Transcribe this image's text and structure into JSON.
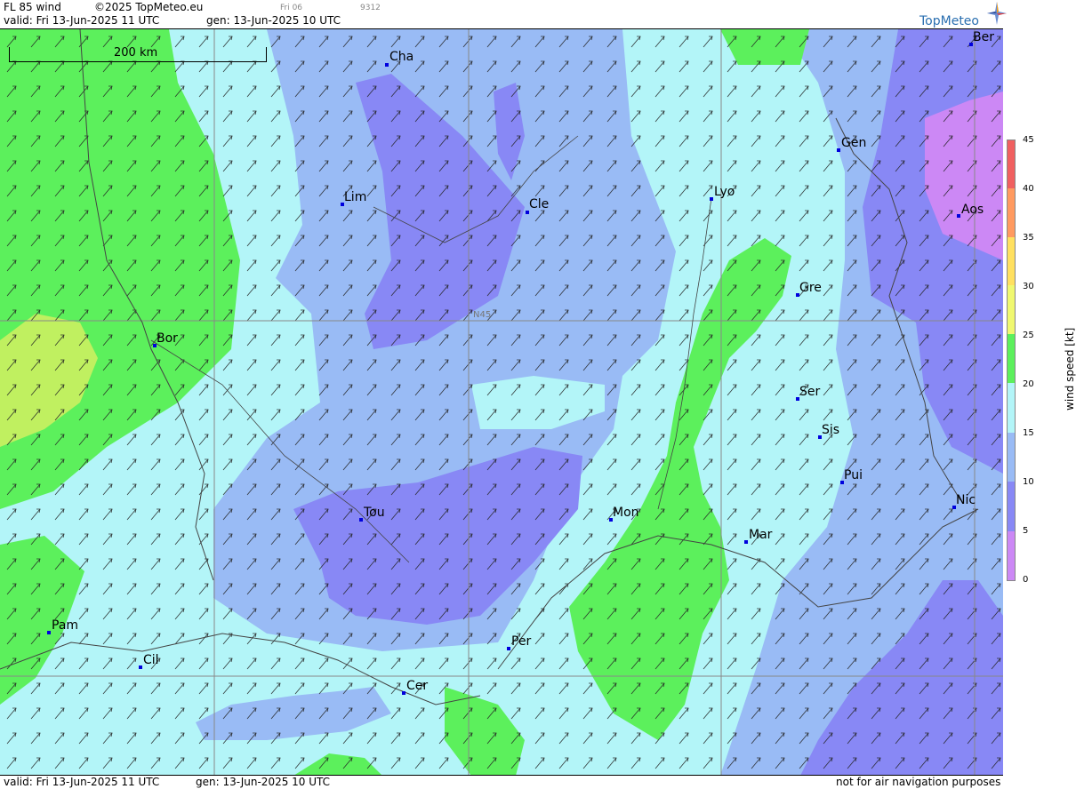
{
  "header": {
    "product": "FL 85 wind",
    "copyright": "©2025 TopMeteo.eu",
    "small_time": "Fri 06",
    "small_code": "9312",
    "valid": "valid:  Fri  13-Jun-2025  11 UTC",
    "gen": "gen: 13-Jun-2025 10 UTC"
  },
  "logo": {
    "text": "TopMeteo"
  },
  "map": {
    "scale_label": "200 km",
    "grid_label": "N45",
    "cities": [
      {
        "name": "Cha"
      },
      {
        "name": "Ber"
      },
      {
        "name": "Gen"
      },
      {
        "name": "Lim"
      },
      {
        "name": "Cle"
      },
      {
        "name": "Lyo"
      },
      {
        "name": "Aos"
      },
      {
        "name": "Gre"
      },
      {
        "name": "Bor"
      },
      {
        "name": "Ser"
      },
      {
        "name": "Sis"
      },
      {
        "name": "Pui"
      },
      {
        "name": "Nic"
      },
      {
        "name": "Tou"
      },
      {
        "name": "Mon"
      },
      {
        "name": "Mar"
      },
      {
        "name": "Pam"
      },
      {
        "name": "Per"
      },
      {
        "name": "Cil"
      },
      {
        "name": "Cer"
      }
    ]
  },
  "legend": {
    "title": "wind  speed  [kt]",
    "ticks": [
      "45",
      "40",
      "35",
      "30",
      "25",
      "20",
      "15",
      "10",
      "5",
      "0"
    ],
    "colors": [
      "#f06060",
      "#ff9a60",
      "#ffe060",
      "#f0f870",
      "#5cf05c",
      "#b3f5f8",
      "#99bbf5",
      "#8888f5",
      "#cc88f5"
    ]
  },
  "footer": {
    "valid": "valid:  Fri  13-Jun-2025  11 UTC",
    "gen": "gen: 13-Jun-2025 10 UTC",
    "notice": "not for air navigation purposes"
  }
}
